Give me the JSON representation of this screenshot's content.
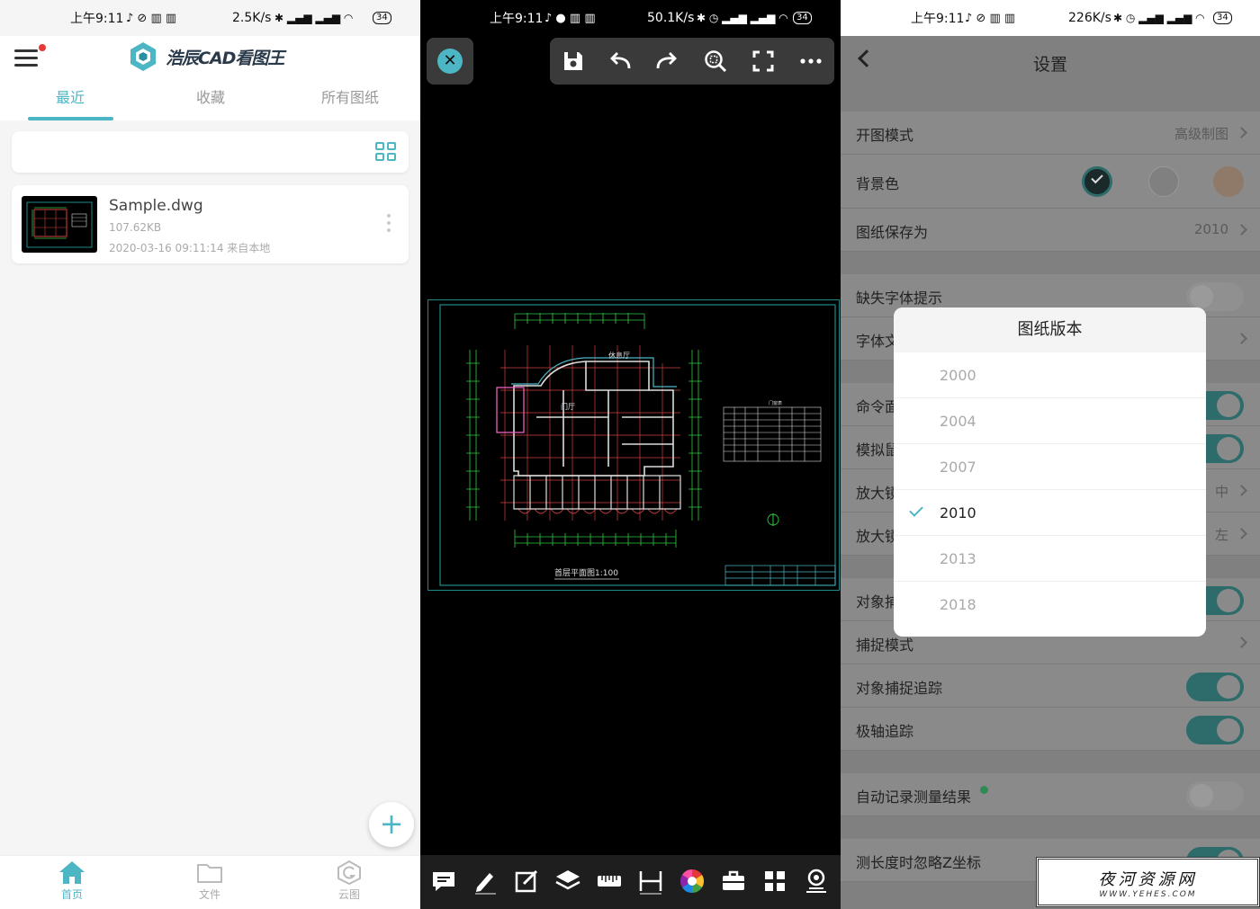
{
  "status_bars": [
    {
      "time": "上午9:11",
      "speed": "2.5K/s",
      "battery": "34"
    },
    {
      "time": "上午9:11",
      "speed": "50.1K/s",
      "battery": "34"
    },
    {
      "time": "上午9:11",
      "speed": "226K/s",
      "battery": "34"
    }
  ],
  "home": {
    "app_title": "浩辰CAD看图王",
    "tabs": [
      "最近",
      "收藏",
      "所有图纸"
    ],
    "file": {
      "name": "Sample.dwg",
      "size": "107.62KB",
      "meta": "2020-03-16 09:11:14  来自本地"
    },
    "fab": "+",
    "bottom_nav": [
      "首页",
      "文件",
      "云图"
    ]
  },
  "viewer": {
    "drawing_caption": "首层平面图1:100",
    "room_labels": [
      "休息厅",
      "门厅",
      "门窗表"
    ]
  },
  "settings": {
    "title": "设置",
    "open_mode": {
      "label": "开图模式",
      "value": "高级制图"
    },
    "bg_color": {
      "label": "背景色"
    },
    "save_as": {
      "label": "图纸保存为",
      "value": "2010"
    },
    "missing_font": {
      "label": "缺失字体提示"
    },
    "font_row": {
      "label": "字体文"
    },
    "cmd_row": {
      "label": "命令面"
    },
    "sim_row": {
      "label": "模拟鼠"
    },
    "zoom1": {
      "label": "放大镜",
      "value": "中"
    },
    "zoom2": {
      "label": "放大镜",
      "value": "左"
    },
    "snap_obj": {
      "label": "对象捕"
    },
    "snap_mode": {
      "label": "捕捉模式"
    },
    "snap_track": {
      "label": "对象捕捉追踪"
    },
    "polar": {
      "label": "极轴追踪"
    },
    "auto_record": {
      "label": "自动记录测量结果"
    },
    "ignore_z": {
      "label": "测长度时忽略Z坐标"
    }
  },
  "version_dialog": {
    "title": "图纸版本",
    "options": [
      "2000",
      "2004",
      "2007",
      "2010",
      "2013",
      "2018"
    ],
    "selected": "2010"
  },
  "watermark": {
    "title": "夜河资源网",
    "url": "WWW.YEHES.COM"
  },
  "colors": {
    "accent": "#4db6c5",
    "toggle_on": "#2e6b6b",
    "cad_wall": "#d04040",
    "cad_dim": "#2ecc40"
  }
}
